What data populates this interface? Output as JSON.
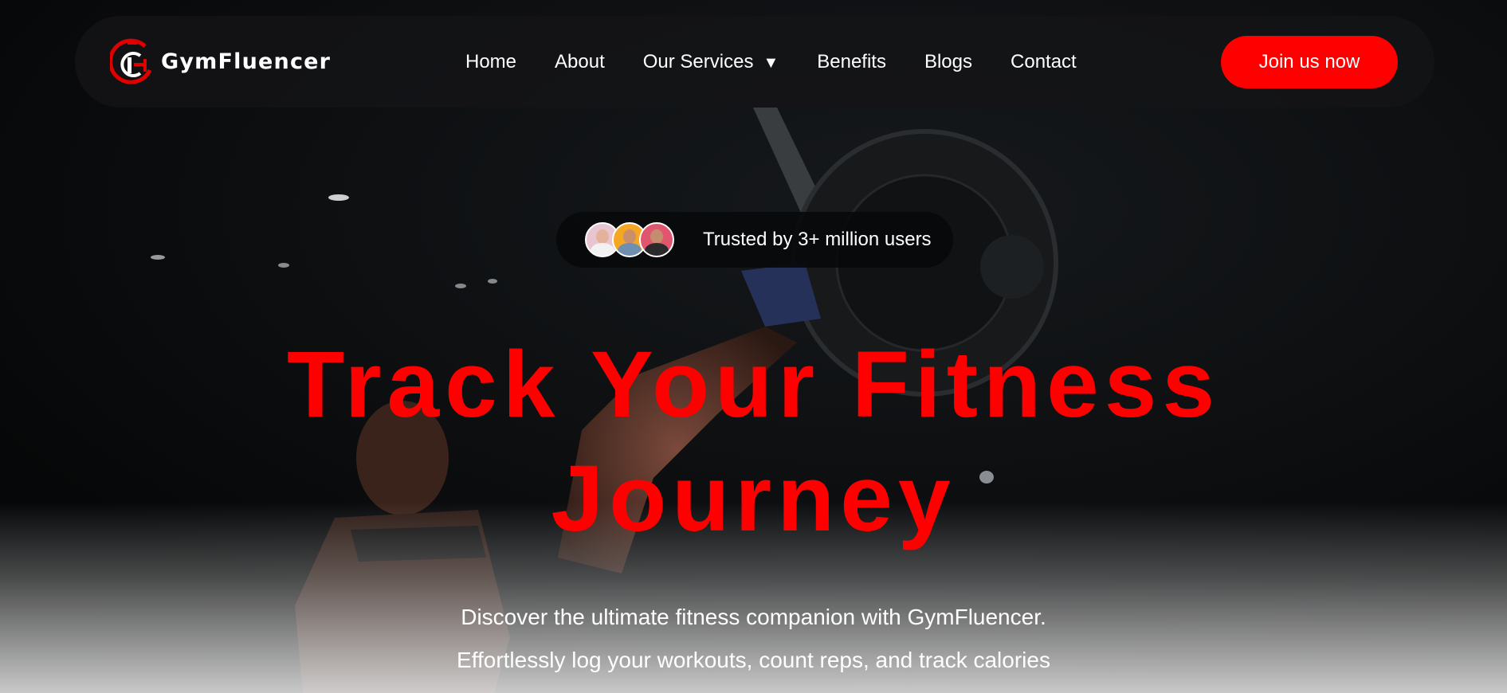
{
  "brand": {
    "name": "GymFluencer",
    "logo_icon": "gymfluencer-logo",
    "accent_color": "#ff0000"
  },
  "nav": {
    "items": [
      {
        "label": "Home"
      },
      {
        "label": "About"
      },
      {
        "label": "Our Services",
        "caret": "▼"
      },
      {
        "label": "Benefits"
      },
      {
        "label": "Blogs"
      },
      {
        "label": "Contact"
      }
    ],
    "cta_label": "Join us now"
  },
  "hero": {
    "trusted_text": "Trusted by 3+ million users",
    "avatar_icons": [
      "avatar-woman",
      "avatar-bearded-man",
      "avatar-man"
    ],
    "headline_line1": "Track Your Fitness",
    "headline_line2": "Journey",
    "subtext": "Discover the ultimate fitness companion with GymFluencer. Effortlessly log your workouts, count reps, and track calories burned. Stay motivated and achieve your goals with ease."
  }
}
